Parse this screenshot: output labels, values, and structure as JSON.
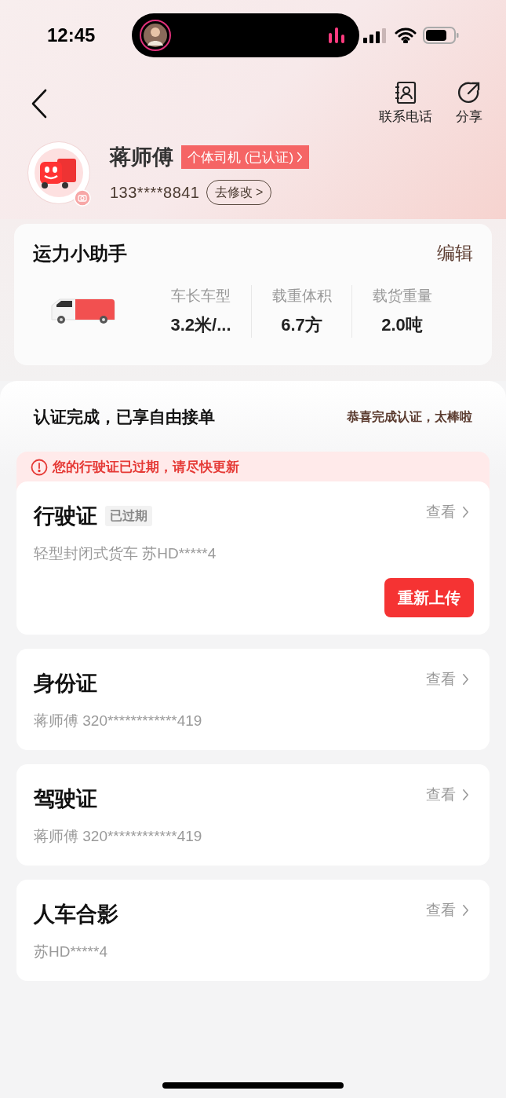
{
  "status_bar": {
    "time": "12:45"
  },
  "header": {
    "actions": [
      {
        "kind": "contact",
        "label": "联系电话"
      },
      {
        "kind": "share",
        "label": "分享"
      }
    ]
  },
  "profile": {
    "name": "蒋师傅",
    "badge": "个体司机 (已认证)",
    "phone": "133****8841",
    "edit_button": "去修改 >"
  },
  "assistant": {
    "title": "运力小助手",
    "edit": "编辑",
    "stats": [
      {
        "label": "车长车型",
        "value": "3.2米/..."
      },
      {
        "label": "载重体积",
        "value": "6.7方"
      },
      {
        "label": "载货重量",
        "value": "2.0吨"
      }
    ]
  },
  "certification": {
    "title": "认证完成，已享自由接单",
    "note": "恭喜完成认证，太棒啦"
  },
  "documents": [
    {
      "title": "行驶证",
      "tag": "已过期",
      "warning": "您的行驶证已过期，请尽快更新",
      "detail": "轻型封闭式货车 苏HD*****4",
      "view": "查看",
      "action": "重新上传"
    },
    {
      "title": "身份证",
      "detail": "蒋师傅 320************419",
      "view": "查看"
    },
    {
      "title": "驾驶证",
      "detail": "蒋师傅 320************419",
      "view": "查看"
    },
    {
      "title": "人车合影",
      "detail": "苏HD*****4",
      "view": "查看"
    }
  ]
}
